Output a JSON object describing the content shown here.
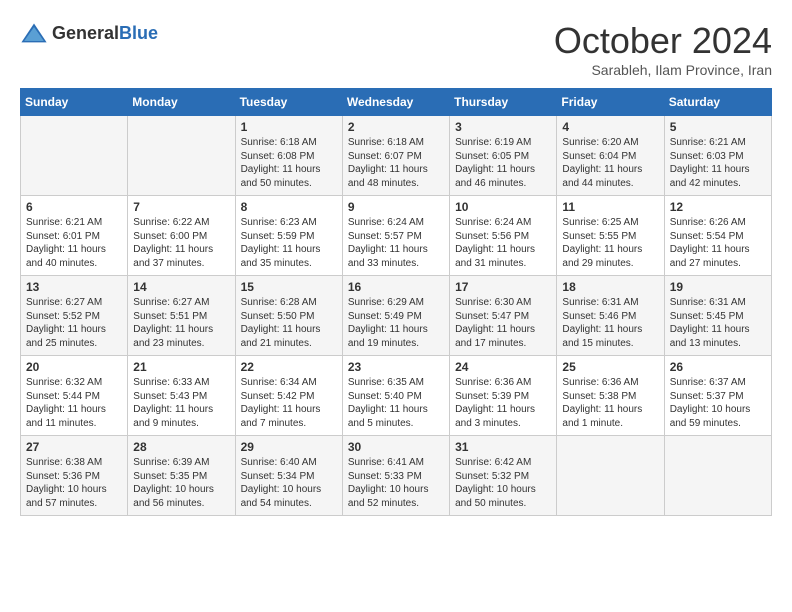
{
  "logo": {
    "general": "General",
    "blue": "Blue"
  },
  "title": "October 2024",
  "location": "Sarableh, Ilam Province, Iran",
  "weekdays": [
    "Sunday",
    "Monday",
    "Tuesday",
    "Wednesday",
    "Thursday",
    "Friday",
    "Saturday"
  ],
  "weeks": [
    [
      {
        "day": "",
        "sunrise": "",
        "sunset": "",
        "daylight": ""
      },
      {
        "day": "",
        "sunrise": "",
        "sunset": "",
        "daylight": ""
      },
      {
        "day": "1",
        "sunrise": "Sunrise: 6:18 AM",
        "sunset": "Sunset: 6:08 PM",
        "daylight": "Daylight: 11 hours and 50 minutes."
      },
      {
        "day": "2",
        "sunrise": "Sunrise: 6:18 AM",
        "sunset": "Sunset: 6:07 PM",
        "daylight": "Daylight: 11 hours and 48 minutes."
      },
      {
        "day": "3",
        "sunrise": "Sunrise: 6:19 AM",
        "sunset": "Sunset: 6:05 PM",
        "daylight": "Daylight: 11 hours and 46 minutes."
      },
      {
        "day": "4",
        "sunrise": "Sunrise: 6:20 AM",
        "sunset": "Sunset: 6:04 PM",
        "daylight": "Daylight: 11 hours and 44 minutes."
      },
      {
        "day": "5",
        "sunrise": "Sunrise: 6:21 AM",
        "sunset": "Sunset: 6:03 PM",
        "daylight": "Daylight: 11 hours and 42 minutes."
      }
    ],
    [
      {
        "day": "6",
        "sunrise": "Sunrise: 6:21 AM",
        "sunset": "Sunset: 6:01 PM",
        "daylight": "Daylight: 11 hours and 40 minutes."
      },
      {
        "day": "7",
        "sunrise": "Sunrise: 6:22 AM",
        "sunset": "Sunset: 6:00 PM",
        "daylight": "Daylight: 11 hours and 37 minutes."
      },
      {
        "day": "8",
        "sunrise": "Sunrise: 6:23 AM",
        "sunset": "Sunset: 5:59 PM",
        "daylight": "Daylight: 11 hours and 35 minutes."
      },
      {
        "day": "9",
        "sunrise": "Sunrise: 6:24 AM",
        "sunset": "Sunset: 5:57 PM",
        "daylight": "Daylight: 11 hours and 33 minutes."
      },
      {
        "day": "10",
        "sunrise": "Sunrise: 6:24 AM",
        "sunset": "Sunset: 5:56 PM",
        "daylight": "Daylight: 11 hours and 31 minutes."
      },
      {
        "day": "11",
        "sunrise": "Sunrise: 6:25 AM",
        "sunset": "Sunset: 5:55 PM",
        "daylight": "Daylight: 11 hours and 29 minutes."
      },
      {
        "day": "12",
        "sunrise": "Sunrise: 6:26 AM",
        "sunset": "Sunset: 5:54 PM",
        "daylight": "Daylight: 11 hours and 27 minutes."
      }
    ],
    [
      {
        "day": "13",
        "sunrise": "Sunrise: 6:27 AM",
        "sunset": "Sunset: 5:52 PM",
        "daylight": "Daylight: 11 hours and 25 minutes."
      },
      {
        "day": "14",
        "sunrise": "Sunrise: 6:27 AM",
        "sunset": "Sunset: 5:51 PM",
        "daylight": "Daylight: 11 hours and 23 minutes."
      },
      {
        "day": "15",
        "sunrise": "Sunrise: 6:28 AM",
        "sunset": "Sunset: 5:50 PM",
        "daylight": "Daylight: 11 hours and 21 minutes."
      },
      {
        "day": "16",
        "sunrise": "Sunrise: 6:29 AM",
        "sunset": "Sunset: 5:49 PM",
        "daylight": "Daylight: 11 hours and 19 minutes."
      },
      {
        "day": "17",
        "sunrise": "Sunrise: 6:30 AM",
        "sunset": "Sunset: 5:47 PM",
        "daylight": "Daylight: 11 hours and 17 minutes."
      },
      {
        "day": "18",
        "sunrise": "Sunrise: 6:31 AM",
        "sunset": "Sunset: 5:46 PM",
        "daylight": "Daylight: 11 hours and 15 minutes."
      },
      {
        "day": "19",
        "sunrise": "Sunrise: 6:31 AM",
        "sunset": "Sunset: 5:45 PM",
        "daylight": "Daylight: 11 hours and 13 minutes."
      }
    ],
    [
      {
        "day": "20",
        "sunrise": "Sunrise: 6:32 AM",
        "sunset": "Sunset: 5:44 PM",
        "daylight": "Daylight: 11 hours and 11 minutes."
      },
      {
        "day": "21",
        "sunrise": "Sunrise: 6:33 AM",
        "sunset": "Sunset: 5:43 PM",
        "daylight": "Daylight: 11 hours and 9 minutes."
      },
      {
        "day": "22",
        "sunrise": "Sunrise: 6:34 AM",
        "sunset": "Sunset: 5:42 PM",
        "daylight": "Daylight: 11 hours and 7 minutes."
      },
      {
        "day": "23",
        "sunrise": "Sunrise: 6:35 AM",
        "sunset": "Sunset: 5:40 PM",
        "daylight": "Daylight: 11 hours and 5 minutes."
      },
      {
        "day": "24",
        "sunrise": "Sunrise: 6:36 AM",
        "sunset": "Sunset: 5:39 PM",
        "daylight": "Daylight: 11 hours and 3 minutes."
      },
      {
        "day": "25",
        "sunrise": "Sunrise: 6:36 AM",
        "sunset": "Sunset: 5:38 PM",
        "daylight": "Daylight: 11 hours and 1 minute."
      },
      {
        "day": "26",
        "sunrise": "Sunrise: 6:37 AM",
        "sunset": "Sunset: 5:37 PM",
        "daylight": "Daylight: 10 hours and 59 minutes."
      }
    ],
    [
      {
        "day": "27",
        "sunrise": "Sunrise: 6:38 AM",
        "sunset": "Sunset: 5:36 PM",
        "daylight": "Daylight: 10 hours and 57 minutes."
      },
      {
        "day": "28",
        "sunrise": "Sunrise: 6:39 AM",
        "sunset": "Sunset: 5:35 PM",
        "daylight": "Daylight: 10 hours and 56 minutes."
      },
      {
        "day": "29",
        "sunrise": "Sunrise: 6:40 AM",
        "sunset": "Sunset: 5:34 PM",
        "daylight": "Daylight: 10 hours and 54 minutes."
      },
      {
        "day": "30",
        "sunrise": "Sunrise: 6:41 AM",
        "sunset": "Sunset: 5:33 PM",
        "daylight": "Daylight: 10 hours and 52 minutes."
      },
      {
        "day": "31",
        "sunrise": "Sunrise: 6:42 AM",
        "sunset": "Sunset: 5:32 PM",
        "daylight": "Daylight: 10 hours and 50 minutes."
      },
      {
        "day": "",
        "sunrise": "",
        "sunset": "",
        "daylight": ""
      },
      {
        "day": "",
        "sunrise": "",
        "sunset": "",
        "daylight": ""
      }
    ]
  ]
}
